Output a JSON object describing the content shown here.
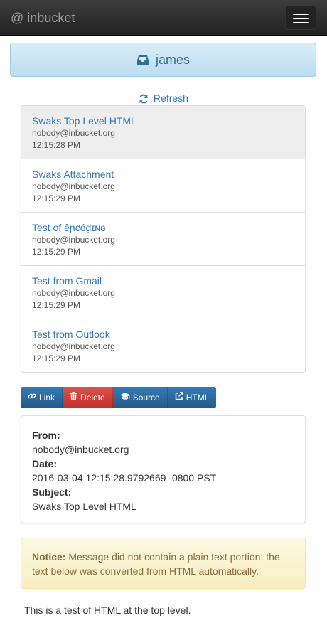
{
  "navbar": {
    "brand_at": "@",
    "brand_name": "inbucket",
    "toggle_icon": "hamburger-menu-icon"
  },
  "mailbox": {
    "icon": "inbox-icon",
    "name": "james"
  },
  "refresh": {
    "icon": "refresh-icon",
    "label": "Refresh"
  },
  "messages": [
    {
      "subject": "Swaks Top Level HTML",
      "from": "nobody@inbucket.org",
      "date": "12:15:28 PM",
      "selected": true
    },
    {
      "subject": "Swaks Attachment",
      "from": "nobody@inbucket.org",
      "date": "12:15:29 PM",
      "selected": false
    },
    {
      "subject": "Test of êɲƈóḍɪɴɢ",
      "from": "nobody@inbucket.org",
      "date": "12:15:29 PM",
      "selected": false
    },
    {
      "subject": "Test from Gmail",
      "from": "nobody@inbucket.org",
      "date": "12:15:29 PM",
      "selected": false
    },
    {
      "subject": "Test from Outlook",
      "from": "nobody@inbucket.org",
      "date": "12:15:29 PM",
      "selected": false
    }
  ],
  "actions": {
    "link_label": "Link",
    "delete_label": "Delete",
    "source_label": "Source",
    "html_label": "HTML"
  },
  "header": {
    "from_label": "From:",
    "from_value": "nobody@inbucket.org",
    "date_label": "Date:",
    "date_value": "2016-03-04 12:15:28.9792669 -0800 PST",
    "subject_label": "Subject:",
    "subject_value": "Swaks Top Level HTML"
  },
  "notice": {
    "label": "Notice:",
    "text": "Message did not contain a plain text portion; the text below was converted from HTML automatically."
  },
  "body_text": "This is a test of HTML at the top level.",
  "colors": {
    "accent": "#337ab7",
    "danger": "#d9534f",
    "info_bg": "#d9edf7",
    "warning_bg": "#fcf8e3"
  }
}
